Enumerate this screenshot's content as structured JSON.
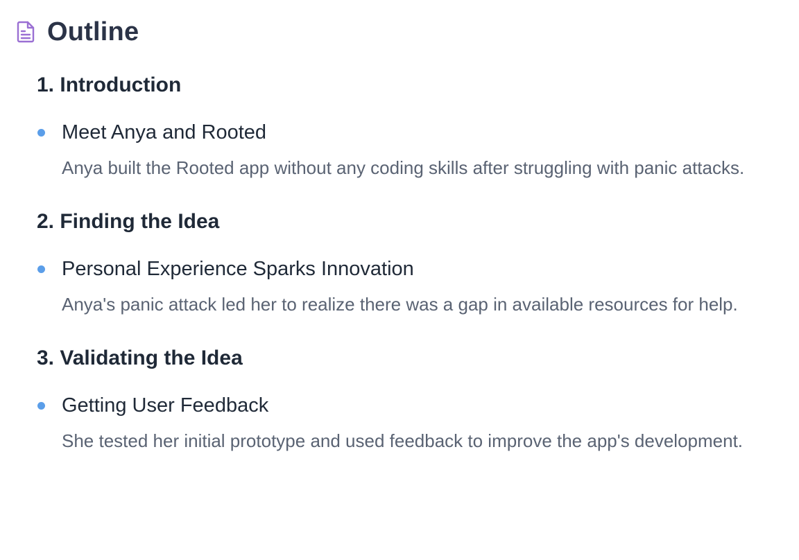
{
  "header": {
    "title": "Outline",
    "icon": "document-icon",
    "icon_color": "#9a6fd3"
  },
  "sections": [
    {
      "heading": "1. Introduction",
      "item": {
        "title": "Meet Anya and Rooted",
        "description": "Anya built the Rooted app without any coding skills after struggling with panic attacks."
      }
    },
    {
      "heading": "2. Finding the Idea",
      "item": {
        "title": "Personal Experience Sparks Innovation",
        "description": "Anya's panic attack led her to realize there was a gap in available resources for help."
      }
    },
    {
      "heading": "3. Validating the Idea",
      "item": {
        "title": "Getting User Feedback",
        "description": "She tested her initial prototype and used feedback to improve the app's development."
      }
    }
  ],
  "colors": {
    "bullet": "#5b9ee9",
    "heading": "#1f2937",
    "description": "#5a6373"
  }
}
